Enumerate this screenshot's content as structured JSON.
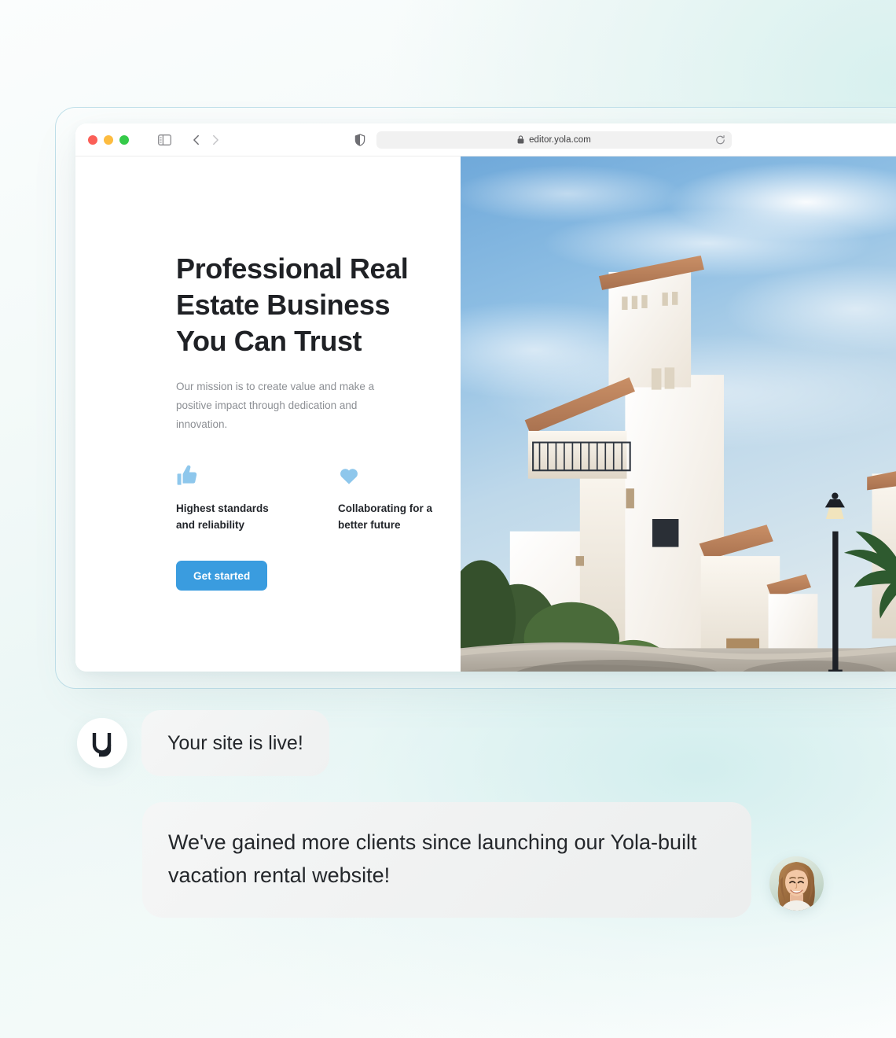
{
  "browser": {
    "url": "editor.yola.com",
    "lock_icon": "lock-icon",
    "reload_icon": "reload-icon",
    "shield_icon": "shield-privacy-icon",
    "sidebar_icon": "sidebar-toggle-icon",
    "back_icon": "chevron-left-icon",
    "forward_icon": "chevron-right-icon",
    "traffic_lights": [
      "close-red",
      "minimize-yellow",
      "zoom-green"
    ]
  },
  "hero": {
    "title": "Professional Real Estate Business You Can Trust",
    "subtitle": "Our mission is to create value and make a positive impact through dedication and innovation.",
    "features": [
      {
        "icon": "thumbs-up-icon",
        "label": "Highest standards and reliability"
      },
      {
        "icon": "heart-icon",
        "label": "Collaborating for a better future"
      }
    ],
    "cta_label": "Get started",
    "photo_alt": "white-mediterranean-villas-street-photo"
  },
  "chat": {
    "logo_letter": "y",
    "messages": [
      {
        "text": "Your site is live!",
        "from": "yola"
      },
      {
        "text": "We've gained more clients since launching our Yola-built vacation rental website!",
        "from": "customer"
      }
    ],
    "avatar_alt": "smiling-woman-avatar"
  },
  "colors": {
    "accent_blue": "#3a9cdf",
    "icon_blue": "#8ec7ec",
    "bubble_gray": "#f2f3f3",
    "heading": "#1f2125",
    "body_text": "#8c8f94",
    "frame_border": "#bfdfe9"
  }
}
